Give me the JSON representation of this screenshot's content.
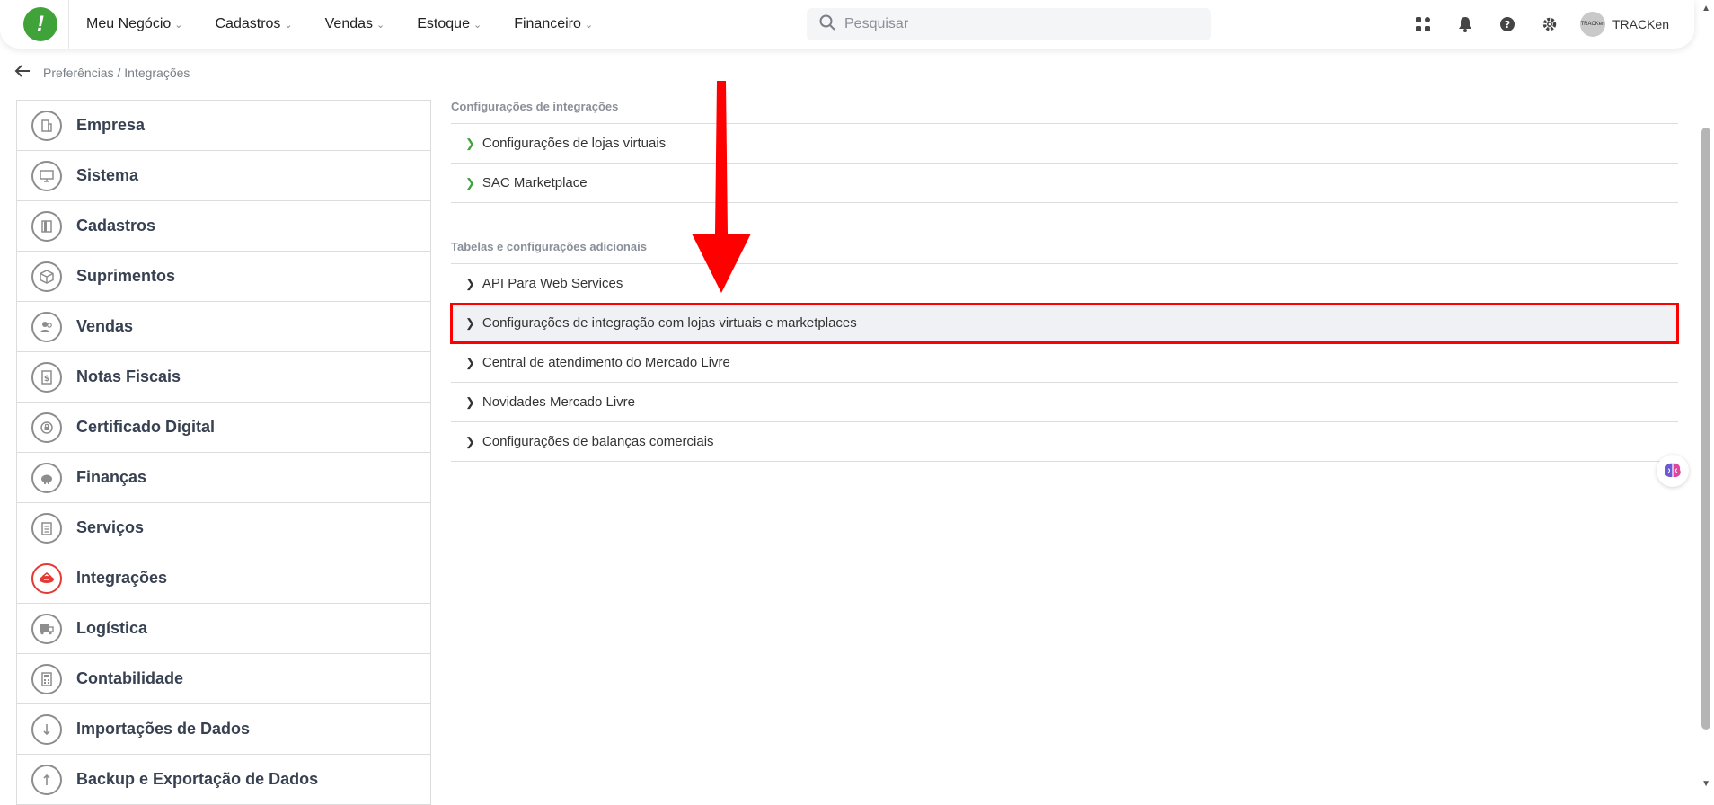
{
  "header": {
    "logo_text": "!",
    "nav": [
      {
        "label": "Meu Negócio"
      },
      {
        "label": "Cadastros"
      },
      {
        "label": "Vendas"
      },
      {
        "label": "Estoque"
      },
      {
        "label": "Financeiro"
      }
    ],
    "search_placeholder": "Pesquisar",
    "avatar_text": "TRACKen",
    "user_name": "TRACKen"
  },
  "breadcrumb": "Preferências / Integrações",
  "sidebar": {
    "items": [
      {
        "label": "Empresa",
        "icon": "building-icon"
      },
      {
        "label": "Sistema",
        "icon": "monitor-icon"
      },
      {
        "label": "Cadastros",
        "icon": "book-icon"
      },
      {
        "label": "Suprimentos",
        "icon": "box-icon"
      },
      {
        "label": "Vendas",
        "icon": "users-icon"
      },
      {
        "label": "Notas Fiscais",
        "icon": "receipt-icon"
      },
      {
        "label": "Certificado Digital",
        "icon": "certificate-icon"
      },
      {
        "label": "Finanças",
        "icon": "piggy-bank-icon"
      },
      {
        "label": "Serviços",
        "icon": "clipboard-icon"
      },
      {
        "label": "Integrações",
        "icon": "integration-icon",
        "active": true
      },
      {
        "label": "Logística",
        "icon": "truck-icon"
      },
      {
        "label": "Contabilidade",
        "icon": "calculator-icon"
      },
      {
        "label": "Importações de Dados",
        "icon": "import-icon"
      },
      {
        "label": "Backup e Exportação de Dados",
        "icon": "export-icon"
      }
    ]
  },
  "sections": [
    {
      "title": "Configurações de integrações",
      "rows": [
        {
          "label": "Configurações de lojas virtuais"
        },
        {
          "label": "SAC Marketplace"
        }
      ]
    },
    {
      "title": "Tabelas e configurações adicionais",
      "rows": [
        {
          "label": "API Para Web Services"
        },
        {
          "label": "Configurações de integração com lojas virtuais e marketplaces"
        },
        {
          "label": "Central de atendimento do Mercado Livre"
        },
        {
          "label": "Novidades Mercado Livre"
        },
        {
          "label": "Configurações de balanças comerciais"
        }
      ]
    }
  ],
  "colors": {
    "brand": "#3fa33a",
    "highlight": "#ff0000",
    "active_icon": "#e53935"
  }
}
